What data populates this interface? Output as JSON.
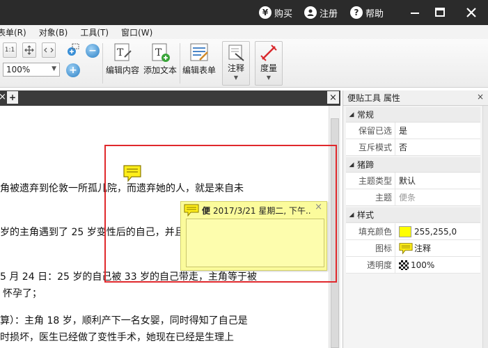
{
  "titlebar": {
    "buy_label": "购买",
    "register_label": "注册",
    "help_label": "帮助"
  },
  "menubar": {
    "items": [
      "表单(R)",
      "对象(B)",
      "工具(T)",
      "窗口(W)"
    ]
  },
  "toolbar": {
    "zoom_value": "100%",
    "edit_content_label": "编辑内容",
    "add_text_label": "添加文本",
    "edit_form_label": "编辑表单",
    "annotation_label": "注释",
    "measure_label": "度量"
  },
  "doc_tabs": {
    "new_tab_label": "+",
    "close_label": "×"
  },
  "document": {
    "lines": [
      "角被遗弃到伦敦一所孤儿院，而遗弃她的人，就是来自未",
      "岁的主角遇到了 25 岁变性后的自己，并且恋爱了；（这主",
      "5 月 24 日：25 岁的自己被 33 岁的自己带走，主角等于被",
      "怀孕了；",
      "算）：主角 18 岁，顺利产下一名女婴，同时得知了自己是",
      "时损坏，医生已经做了变性手术，她现在已经是生理上"
    ]
  },
  "note_popup": {
    "author": "便",
    "datetime": "2017/3/21 星期二, 下午..",
    "close": "×"
  },
  "panel": {
    "title": "便贴工具 属性",
    "close": "×",
    "groups": [
      {
        "label": "常规",
        "rows": [
          {
            "key": "保留已选",
            "value": "是"
          },
          {
            "key": "互斥模式",
            "value": "否"
          }
        ]
      },
      {
        "label": "猪蹄",
        "rows": [
          {
            "key": "主题类型",
            "value": "默认"
          },
          {
            "key": "主题",
            "value": "便条"
          }
        ]
      },
      {
        "label": "样式",
        "rows": [
          {
            "key": "填充颜色",
            "value": "255,255,0"
          },
          {
            "key": "图标",
            "value": "注释"
          },
          {
            "key": "透明度",
            "value": "100%"
          }
        ]
      }
    ]
  },
  "colors": {
    "fill_color": "#ffff00",
    "selection_border": "#e0282c",
    "note_background": "#fbfb9c",
    "titlebar": "#2b2b2b"
  }
}
